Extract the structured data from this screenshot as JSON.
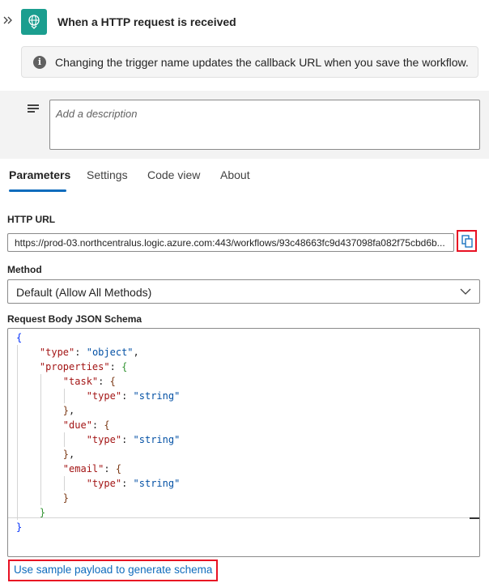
{
  "header": {
    "title": "When a HTTP request is received",
    "collapse_icon": "double-chevron-icon",
    "trigger_icon": "http-globe-icon",
    "accent_color": "#1b9e8f"
  },
  "info_bar": {
    "icon": "info-icon",
    "text": "Changing the trigger name updates the callback URL when you save the workflow."
  },
  "description": {
    "placeholder": "Add a description",
    "icon": "text-lines-icon"
  },
  "tabs": [
    {
      "label": "Parameters",
      "active": true
    },
    {
      "label": "Settings",
      "active": false
    },
    {
      "label": "Code view",
      "active": false
    },
    {
      "label": "About",
      "active": false
    }
  ],
  "http_url": {
    "label": "HTTP URL",
    "value": "https://prod-03.northcentralus.logic.azure.com:443/workflows/93c48663fc9d437098fa082f75cbd6b...",
    "copy_icon": "copy-icon"
  },
  "method": {
    "label": "Method",
    "value": "Default (Allow All Methods)"
  },
  "schema": {
    "label": "Request Body JSON Schema",
    "lines": [
      "{",
      "    \"type\": \"object\",",
      "    \"properties\": {",
      "        \"task\": {",
      "            \"type\": \"string\"",
      "        },",
      "        \"due\": {",
      "            \"type\": \"string\"",
      "        },",
      "        \"email\": {",
      "            \"type\": \"string\"",
      "        }",
      "    }",
      "}"
    ]
  },
  "sample_link": "Use sample payload to generate schema",
  "highlight_color": "#e81123",
  "link_color": "#0f6cbd"
}
